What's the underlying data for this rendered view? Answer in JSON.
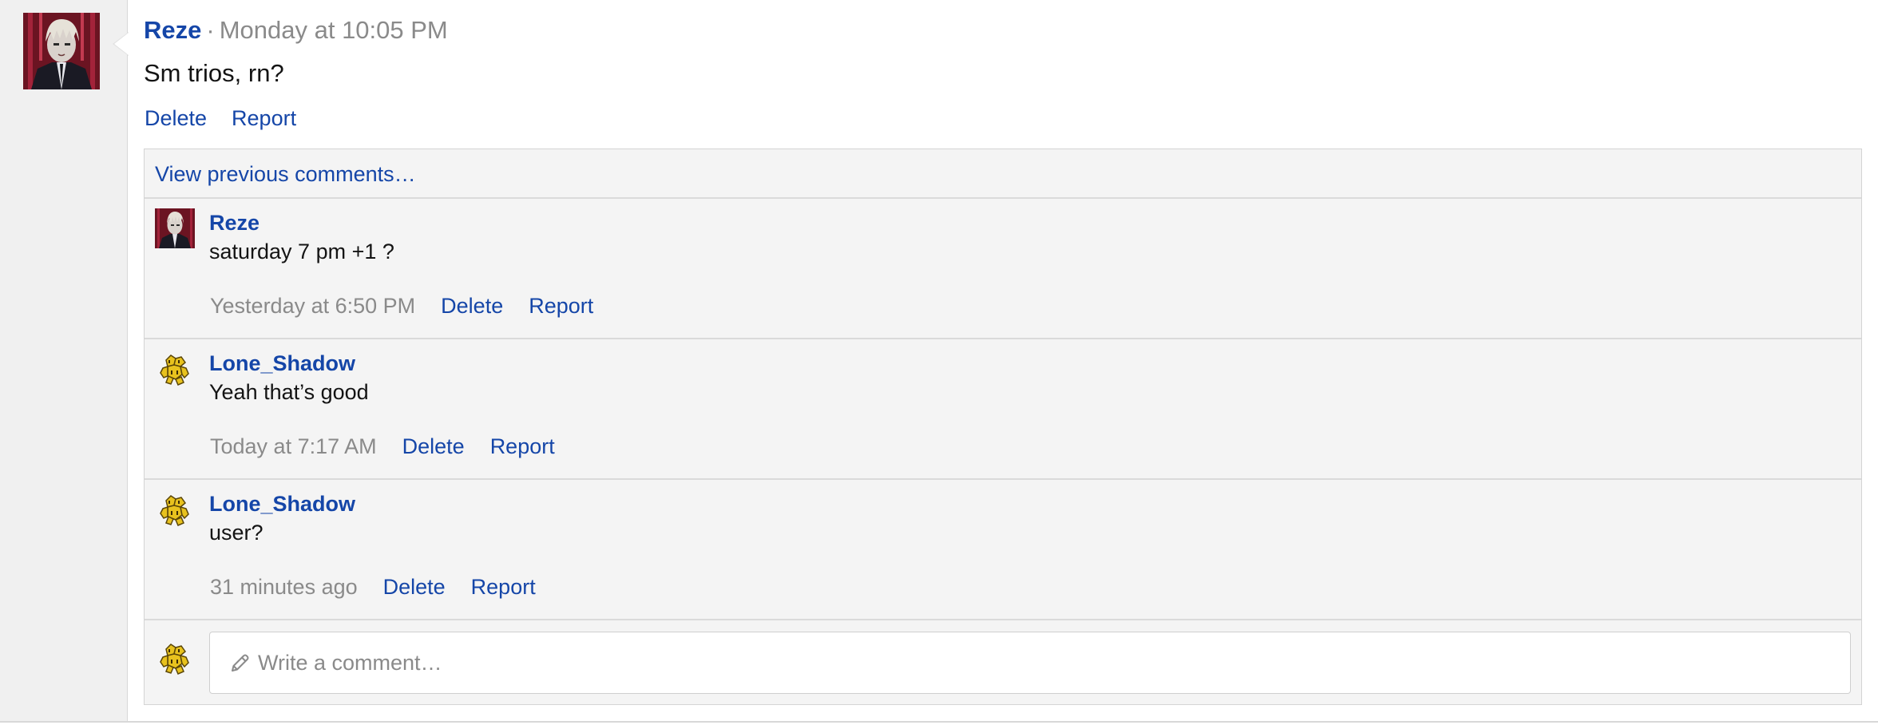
{
  "post": {
    "author": "Reze",
    "separator": "·",
    "time": "Monday at 10:05 PM",
    "body": "Sm trios, rn?",
    "actions": {
      "delete": "Delete",
      "report": "Report"
    },
    "avatar": "reze-avatar"
  },
  "comments_box": {
    "view_previous": "View previous comments…",
    "comments": [
      {
        "author": "Reze",
        "text": "saturday 7 pm +1 ?",
        "time": "Yesterday at 6:50 PM",
        "delete": "Delete",
        "report": "Report",
        "avatar": "reze-avatar"
      },
      {
        "author": "Lone_Shadow",
        "text": "Yeah that’s good",
        "time": "Today at 7:17 AM",
        "delete": "Delete",
        "report": "Report",
        "avatar": "lone-shadow-avatar"
      },
      {
        "author": "Lone_Shadow",
        "text": "user?",
        "time": "31 minutes ago",
        "delete": "Delete",
        "report": "Report",
        "avatar": "lone-shadow-avatar"
      }
    ],
    "composer": {
      "placeholder": "Write a comment…",
      "icon": "pencil-icon",
      "avatar": "lone-shadow-avatar"
    }
  },
  "colors": {
    "link": "#1546a8",
    "muted": "#8a8a8a",
    "panel": "#f4f4f4",
    "gutter": "#f0f0f0"
  }
}
